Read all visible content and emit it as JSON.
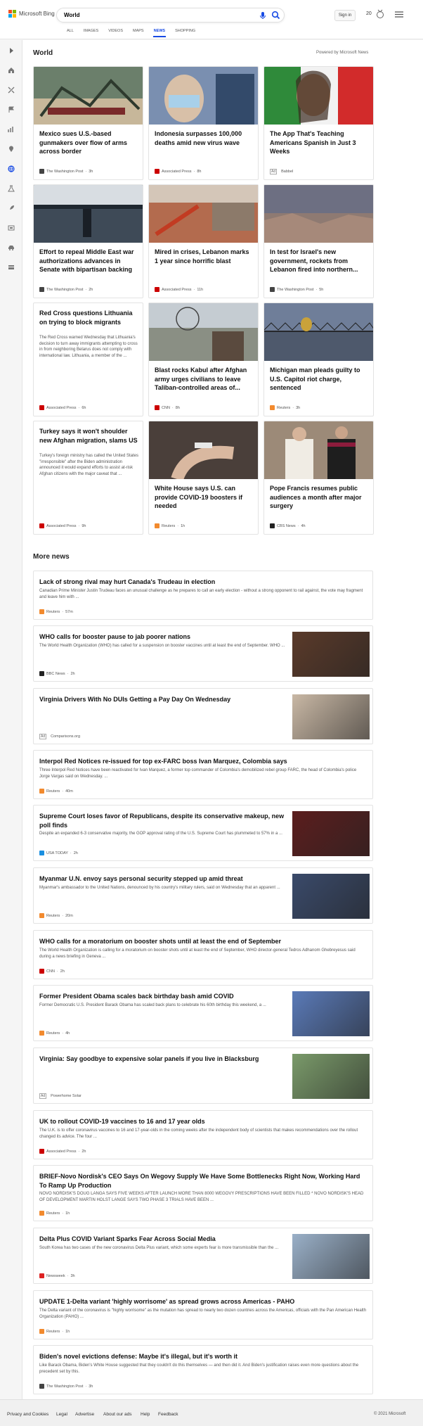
{
  "header": {
    "brand": "Microsoft Bing",
    "search_value": "World",
    "signin": "Sign in",
    "points": "20",
    "tabs": [
      "ALL",
      "IMAGES",
      "VIDEOS",
      "MAPS",
      "NEWS",
      "SHOPPING"
    ],
    "active_tab": "NEWS"
  },
  "rail": [
    "chevron-right-icon",
    "home-icon",
    "sport-icon",
    "flag-icon",
    "money-icon",
    "pin-icon",
    "globe-icon",
    "science-icon",
    "rocket-icon",
    "film-icon",
    "car-icon",
    "wallet-icon"
  ],
  "section": {
    "title": "World",
    "powered": "Powered by Microsoft News"
  },
  "cards": [
    {
      "title": "Mexico sues U.S.-based gunmakers over flow of arms across border",
      "source": "The Washington Post",
      "time": "3h",
      "color": "#6b7f6b",
      "logo": "#444"
    },
    {
      "title": "Indonesia surpasses 100,000 deaths amid new virus wave",
      "source": "Associated Press",
      "time": "8h",
      "color": "#7a8fb0",
      "logo": "#c00"
    },
    {
      "title": "The App That's Teaching Americans Spanish in Just 3 Weeks",
      "source": "Babbel",
      "time": "",
      "ad": "Ad",
      "color": "#c04040",
      "logo": ""
    },
    {
      "title": "Effort to repeal Middle East war authorizations advances in Senate with bipartisan backing",
      "source": "The Washington Post",
      "time": "2h",
      "color": "#3e4a57",
      "logo": "#444"
    },
    {
      "title": "Mired in crises, Lebanon marks 1 year since horrific blast",
      "source": "Associated Press",
      "time": "11h",
      "color": "#b36b4e",
      "logo": "#c00"
    },
    {
      "title": "In test for Israel's new government, rockets from Lebanon fired into northern...",
      "source": "The Washington Post",
      "time": "5h",
      "color": "#8e7a72",
      "logo": "#444"
    },
    {
      "title": "Red Cross questions Lithuania on trying to block migrants",
      "abstract": "The Red Cross warned Wednesday that Lithuania's decision to turn away immigrants attempting to cross in from neighboring Belarus does not comply with international law. Lithuania, a member of the ...",
      "source": "Associated Press",
      "time": "6h",
      "logo": "#c00"
    },
    {
      "title": "Blast rocks Kabul after Afghan army urges civilians to leave Taliban-controlled areas of...",
      "source": "CNN",
      "time": "8h",
      "color": "#8a8f84",
      "logo": "#c00"
    },
    {
      "title": "Michigan man pleads guilty to U.S. Capitol riot charge, sentenced",
      "source": "Reuters",
      "time": "3h",
      "color": "#6f7e99",
      "logo": "#f28a2e"
    },
    {
      "title": "Turkey says it won't shoulder new Afghan migration, slams US",
      "abstract": "Turkey's foreign ministry has called the United States \"irresponsible\" after the Biden administration announced it would expand efforts to assist at-risk Afghan citizens with the major caveat that ...",
      "source": "Associated Press",
      "time": "9h",
      "logo": "#c00"
    },
    {
      "title": "White House says U.S. can provide COVID-19 boosters if needed",
      "source": "Reuters",
      "time": "1h",
      "color": "#4a3f3a",
      "logo": "#f28a2e"
    },
    {
      "title": "Pope Francis resumes public audiences a month after major surgery",
      "source": "CBS News",
      "time": "4h",
      "color": "#9c8a78",
      "logo": "#222"
    }
  ],
  "more": {
    "title": "More news"
  },
  "rows": [
    {
      "title": "Lack of strong rival may hurt Canada's Trudeau in election",
      "summary": "Canadian Prime Minister Justin Trudeau faces an unusual challenge as he prepares to call an early election - without a strong opponent to rail against, the vote may fragment and leave him with ...",
      "source": "Reuters",
      "time": "57m",
      "logo": "#f28a2e"
    },
    {
      "title": "WHO calls for booster pause to jab poorer nations",
      "summary": "The World Health Organization (WHO) has called for a suspension on booster vaccines until at least the end of September. WHO ...",
      "source": "BBC News",
      "time": "2h",
      "logo": "#222",
      "img": "#5a3a2a"
    },
    {
      "title": "Virginia Drivers With No DUIs Getting a Pay Day On Wednesday",
      "summary": "",
      "source": "Comparisons.org",
      "time": "",
      "ad": "Ad",
      "logo": "",
      "img": "#c9b8a5"
    },
    {
      "title": "Interpol Red Notices re-issued for top ex-FARC boss Ivan Marquez, Colombia says",
      "summary": "Three Interpol Red Notices have been reactivated for Ivan Marquez, a former top commander of Colombia's demobilized rebel group FARC, the head of Colombia's police Jorge Vargas said on Wednesday. ...",
      "source": "Reuters",
      "time": "40m",
      "logo": "#f28a2e"
    },
    {
      "title": "Supreme Court loses favor of Republicans, despite its conservative makeup, new poll finds",
      "summary": "Despite an expanded 6-3 conservative majority, the GOP approval rating of the U.S. Supreme Court has plummeted to 57% in a ...",
      "source": "USA TODAY",
      "time": "2h",
      "logo": "#1a8fe0",
      "img": "#5b1e1e"
    },
    {
      "title": "Myanmar U.N. envoy says personal security stepped up amid threat",
      "summary": "Myanmar's ambassador to the United Nations, denounced by his country's military rulers, said on Wednesday that an apparent ...",
      "source": "Reuters",
      "time": "20m",
      "logo": "#f28a2e",
      "img": "#3a4a6a"
    },
    {
      "title": "WHO calls for a moratorium on booster shots until at least the end of September",
      "summary": "The World Health Organization is calling for a moratorium on booster shots until at least the end of September, WHO director-general Tedros Adhanom Ghebreyesus said during a news briefing in Geneva ...",
      "source": "CNN",
      "time": "2h",
      "logo": "#c00"
    },
    {
      "title": "Former President Obama scales back birthday bash amid COVID",
      "summary": "Former Democratic U.S. President Barack Obama has scaled back plans to celebrate his 60th birthday this weekend, a ...",
      "source": "Reuters",
      "time": "4h",
      "logo": "#f28a2e",
      "img": "#5a7ab8"
    },
    {
      "title": "Virginia: Say goodbye to expensive solar panels if you live in Blacksburg",
      "summary": "",
      "source": "Powerhome Solar",
      "time": "",
      "ad": "Ad",
      "logo": "",
      "img": "#7a9a6a"
    },
    {
      "title": "UK to rollout COVID-19 vaccines to 16 and 17 year olds",
      "summary": "The U.K. is to offer coronavirus vaccines to 16 and 17-year-olds in the coming weeks after the independent body of scientists that makes recommendations over the rollout changed its advice. The four ...",
      "source": "Associated Press",
      "time": "2h",
      "logo": "#c00"
    },
    {
      "title": "BRIEF-Novo Nordisk's CEO Says On Wegovy Supply We Have Some Bottlenecks Right Now, Working Hard To Ramp Up Production",
      "summary": "NOVO NORDISK'S DOUG LANGA SAYS FIVE WEEKS AFTER LAUNCH MORE THAN 8000 WEGOVY PRESCRIPTIONS HAVE BEEN FILLED * NOVO NORDISK'S HEAD OF DEVELOPMENT MARTIN HOLST LANGE SAYS TWO PHASE 3 TRIALS HAVE BEEN ...",
      "source": "Reuters",
      "time": "1h",
      "logo": "#f28a2e"
    },
    {
      "title": "Delta Plus COVID Variant Sparks Fear Across Social Media",
      "summary": "South Korea has two cases of the new coronavirus Delta Plus variant, which some experts fear is more transmissible than the ...",
      "source": "Newsweek",
      "time": "3h",
      "logo": "#d22",
      "img": "#9ab0c8"
    },
    {
      "title": "UPDATE 1-Delta variant 'highly worrisome' as spread grows across Americas - PAHO",
      "summary": "The Delta variant of the coronavirus is \"highly worrisome\" as the mutation has spread to nearly two dozen countries across the Americas, officials with the Pan American Health Organization (PAHO) ...",
      "source": "Reuters",
      "time": "1h",
      "logo": "#f28a2e"
    },
    {
      "title": "Biden's novel evictions defense: Maybe it's illegal, but it's worth it",
      "summary": "Like Barack Obama, Biden's White House suggested that they couldn't do this themselves — and then did it. And Biden's justification raises even more questions about the precedent set by this.",
      "source": "The Washington Post",
      "time": "3h",
      "logo": "#444"
    }
  ],
  "footer": {
    "links": [
      "Privacy and Cookies",
      "Legal",
      "Advertise",
      "About our ads",
      "Help",
      "Feedback"
    ],
    "copyright": "© 2021 Microsoft"
  }
}
